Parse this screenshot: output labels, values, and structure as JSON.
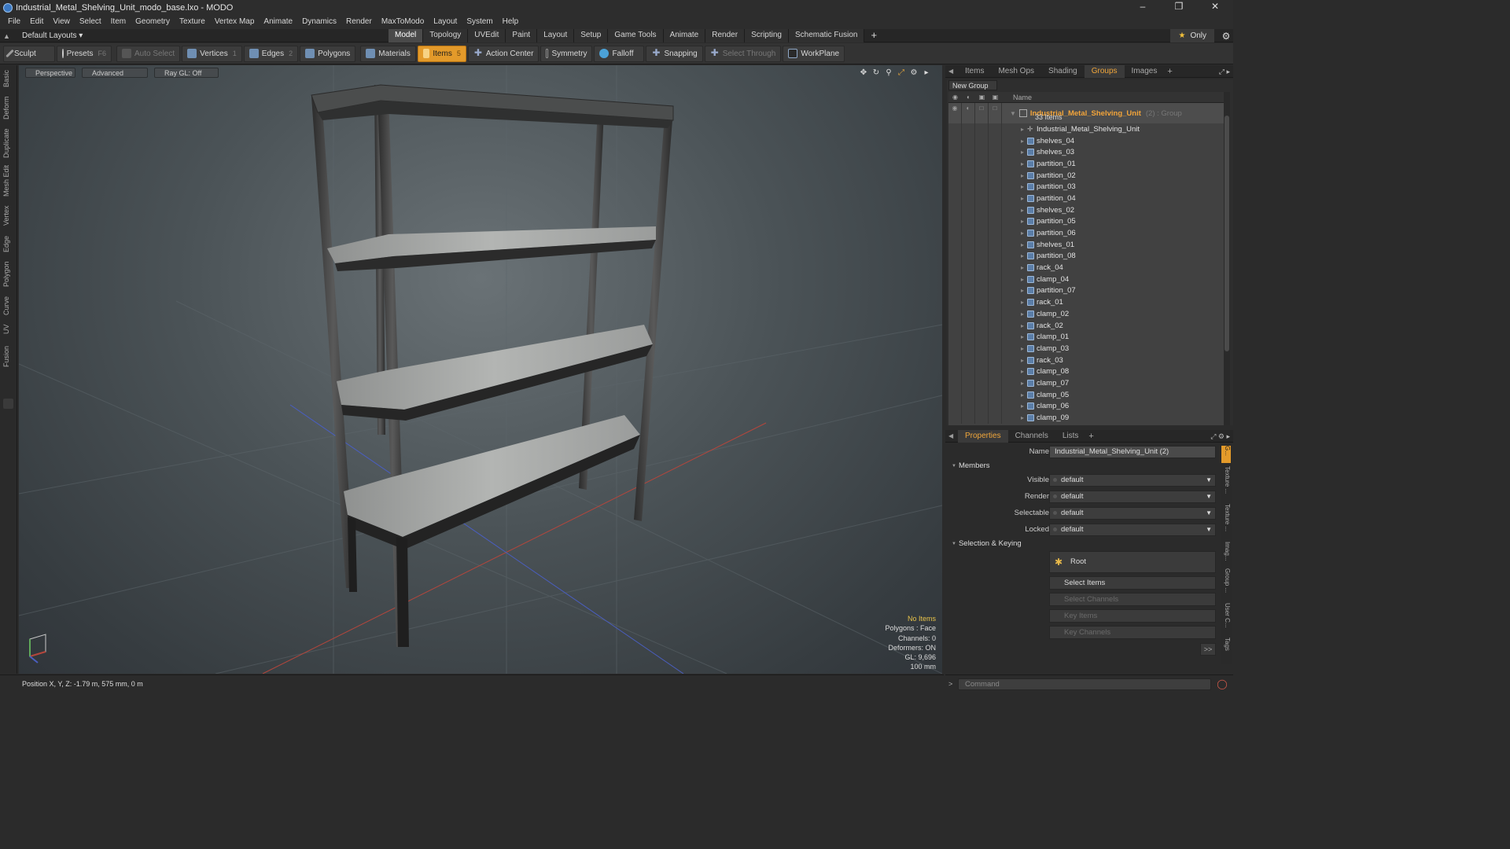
{
  "window": {
    "title": "Industrial_Metal_Shelving_Unit_modo_base.lxo - MODO",
    "controls": [
      "–",
      "❐",
      "✕"
    ]
  },
  "menu": [
    "File",
    "Edit",
    "View",
    "Select",
    "Item",
    "Geometry",
    "Texture",
    "Vertex Map",
    "Animate",
    "Dynamics",
    "Render",
    "MaxToModo",
    "Layout",
    "System",
    "Help"
  ],
  "layouts": {
    "current": "Default Layouts ▾",
    "tabs": [
      "Model",
      "Topology",
      "UVEdit",
      "Paint",
      "Layout",
      "Setup",
      "Game Tools",
      "Animate",
      "Render",
      "Scripting",
      "Schematic Fusion"
    ],
    "active_tab": "Model",
    "only_label": "Only"
  },
  "toolbar": {
    "sculpt": "Sculpt",
    "presets": "Presets",
    "presets_key": "F6",
    "auto_select": "Auto Select",
    "vertices": "Vertices",
    "vertices_key": "1",
    "edges": "Edges",
    "edges_key": "2",
    "polygons": "Polygons",
    "materials": "Materials",
    "items": "Items",
    "items_key": "5",
    "action_center": "Action Center",
    "symmetry": "Symmetry",
    "falloff": "Falloff",
    "snapping": "Snapping",
    "select_through": "Select Through",
    "workplane": "WorkPlane"
  },
  "left_tabs": [
    "Basic",
    "Deform",
    "Duplicate",
    "Mesh Edit",
    "Vertex",
    "Edge",
    "Polygon",
    "Curve",
    "UV",
    "Fusion"
  ],
  "viewport": {
    "view": "Perspective",
    "advanced": "Advanced",
    "raygl": "Ray GL: Off",
    "info": {
      "items": "No Items",
      "polygons": "Polygons : Face",
      "channels": "Channels: 0",
      "deformers": "Deformers: ON",
      "gl": "GL: 9,696",
      "scale": "100 mm"
    }
  },
  "status": {
    "position": "Position X, Y, Z:  -1.79 m, 575 mm, 0 m"
  },
  "outliner": {
    "tabs": [
      "Items",
      "Mesh Ops",
      "Shading",
      "Groups",
      "Images"
    ],
    "active_tab": "Groups",
    "new_group": "New Group",
    "name_header": "Name",
    "group_name": "Industrial_Metal_Shelving_Unit",
    "group_type": "(2) : Group",
    "group_count": "33 Items",
    "locator": "Industrial_Metal_Shelving_Unit",
    "items": [
      "shelves_04",
      "shelves_03",
      "partition_01",
      "partition_02",
      "partition_03",
      "partition_04",
      "shelves_02",
      "partition_05",
      "partition_06",
      "shelves_01",
      "partition_08",
      "rack_04",
      "clamp_04",
      "partition_07",
      "rack_01",
      "clamp_02",
      "rack_02",
      "clamp_01",
      "clamp_03",
      "rack_03",
      "clamp_08",
      "clamp_07",
      "clamp_05",
      "clamp_06",
      "clamp_09"
    ]
  },
  "properties": {
    "tabs": [
      "Properties",
      "Channels",
      "Lists"
    ],
    "active_tab": "Properties",
    "name_label": "Name",
    "name_value": "Industrial_Metal_Shelving_Unit (2)",
    "members_section": "Members",
    "visible_label": "Visible",
    "visible_value": "default",
    "render_label": "Render",
    "render_value": "default",
    "selectable_label": "Selectable",
    "selectable_value": "default",
    "locked_label": "Locked",
    "locked_value": "default",
    "selkey_section": "Selection & Keying",
    "root_button": "Root",
    "select_items": "Select Items",
    "select_channels": "Select Channels",
    "key_items": "Key Items",
    "key_channels": "Key Channels",
    "more": ">>",
    "side_tabs": [
      "G...",
      "Texture ...",
      "Texture ...",
      "Imag...",
      "Group ...",
      "User C...",
      "Tags"
    ]
  },
  "command": {
    "placeholder": "Command"
  },
  "colors": {
    "accent": "#e39a2a",
    "group_name": "#f2a43a",
    "info_warn": "#e8c34a"
  }
}
